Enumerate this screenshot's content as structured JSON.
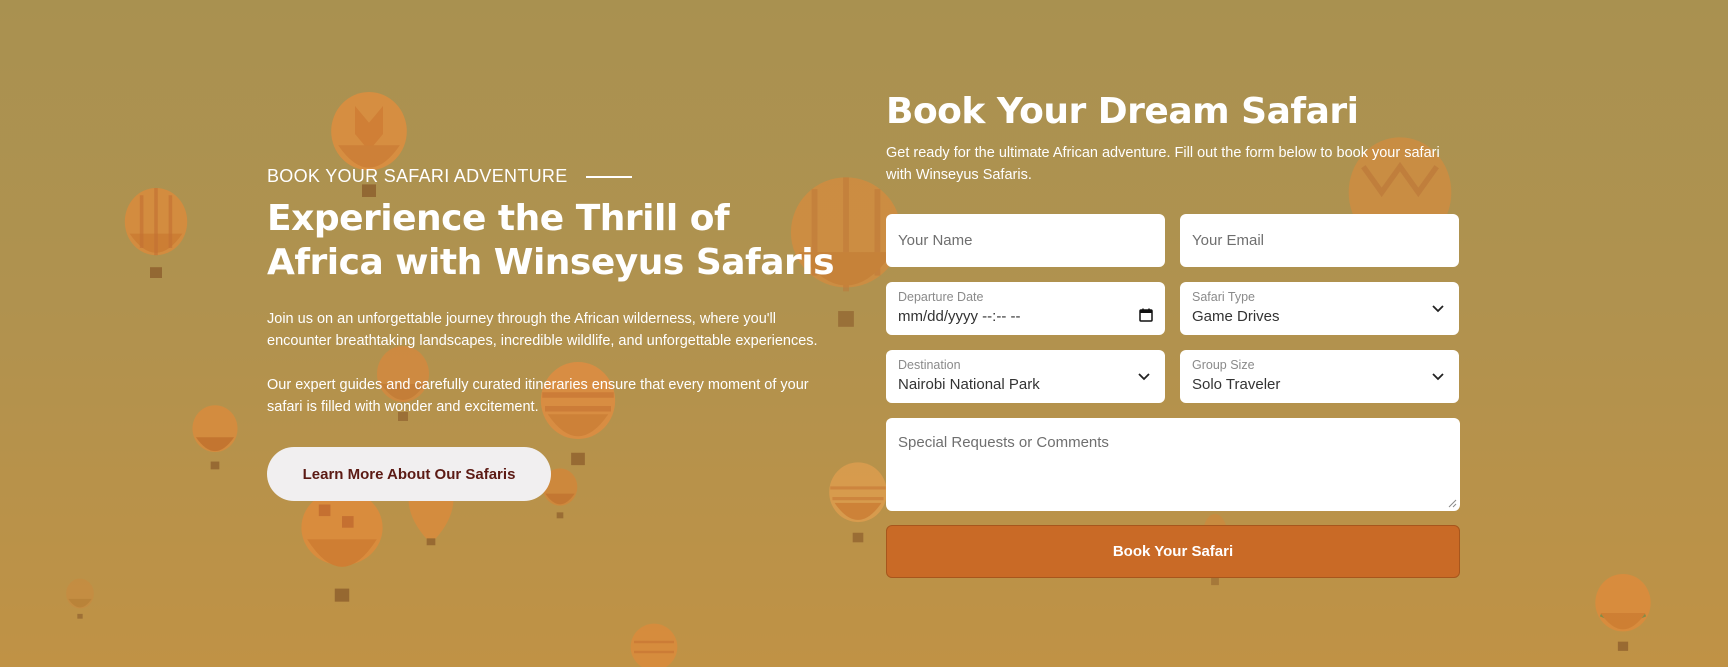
{
  "hero": {
    "eyebrow": "BOOK YOUR SAFARI ADVENTURE",
    "headline": "Experience the Thrill of Africa with Winseyus Safaris",
    "paragraph1": "Join us on an unforgettable journey through the African wilderness, where you'll encounter breathtaking landscapes, incredible wildlife, and unforgettable experiences.",
    "paragraph2": "Our expert guides and carefully curated itineraries ensure that every moment of your safari is filled with wonder and excitement.",
    "learn_more_label": "Learn More About Our Safaris"
  },
  "booking": {
    "title": "Book Your Dream Safari",
    "description": "Get ready for the ultimate African adventure. Fill out the form below to book your safari with Winseyus Safaris.",
    "name_placeholder": "Your Name",
    "email_placeholder": "Your Email",
    "departure_label": "Departure Date",
    "departure_value": "mm/dd/yyyy --:-- --",
    "safari_type_label": "Safari Type",
    "safari_type_value": "Game Drives",
    "destination_label": "Destination",
    "destination_value": "Nairobi National Park",
    "group_size_label": "Group Size",
    "group_size_value": "Solo Traveler",
    "comments_placeholder": "Special Requests or Comments",
    "submit_label": "Book Your Safari"
  },
  "colors": {
    "background_top": "#a99150",
    "background_bottom": "#c09245",
    "submit_button": "#c96a26",
    "learn_button_text": "#5c1a14",
    "balloon_orange": "#e08a3a"
  },
  "icons": {
    "calendar": "calendar-icon",
    "dropdown": "chevron-down-icon",
    "balloons": "hot-air-balloon-icon"
  }
}
